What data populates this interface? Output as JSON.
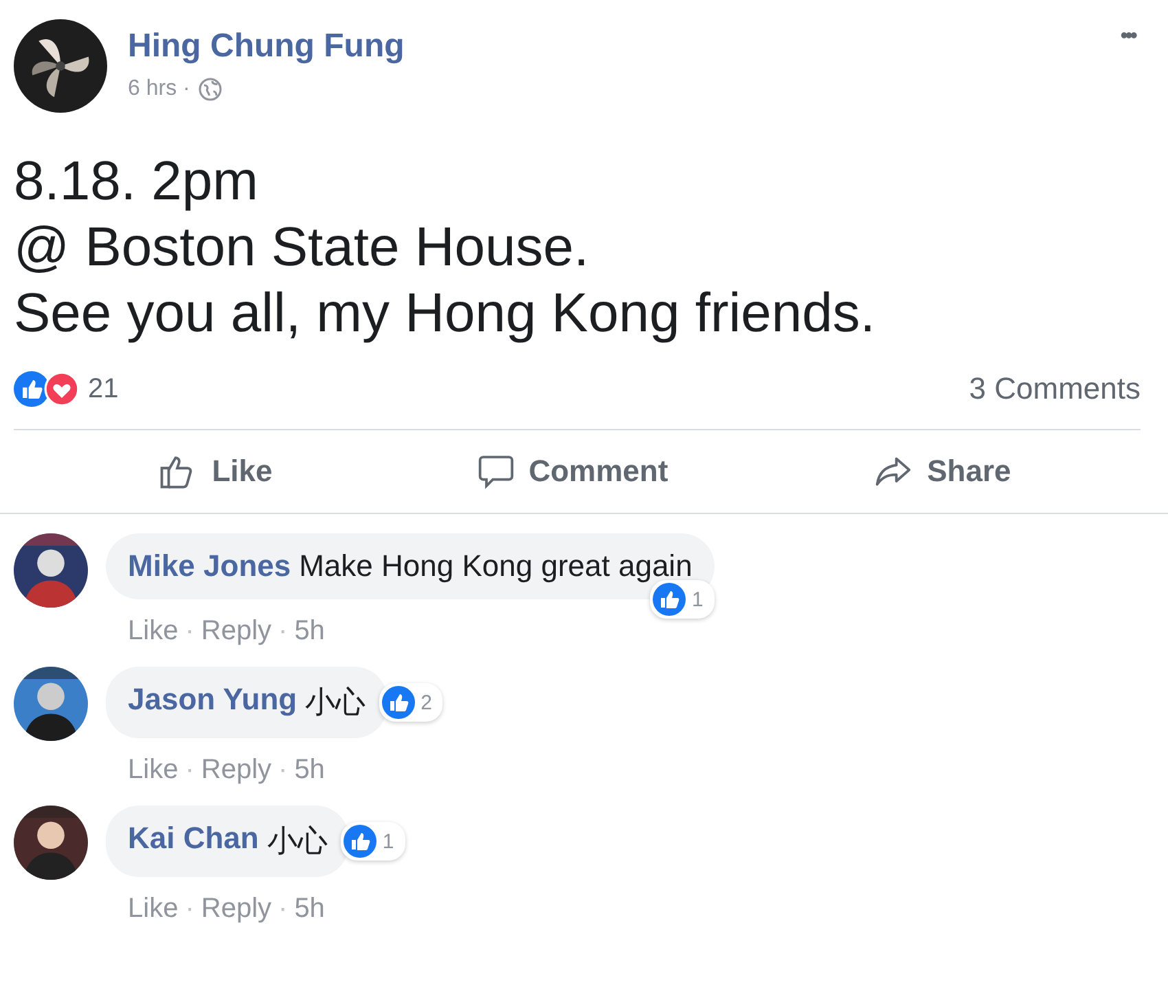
{
  "post": {
    "author": "Hing Chung Fung",
    "time": "6 hrs ·",
    "menu": "•••",
    "lines": [
      "8.18. 2pm",
      "@ Boston State House.",
      "See you all, my Hong Kong friends."
    ],
    "reactions": {
      "count": "21"
    },
    "comments_count": "3 Comments"
  },
  "actions": [
    {
      "kind": "like",
      "label": "Like"
    },
    {
      "kind": "comment",
      "label": "Comment"
    },
    {
      "kind": "share",
      "label": "Share"
    }
  ],
  "comments": [
    {
      "author": "Mike Jones",
      "text": "Make Hong Kong great again",
      "likes": "1",
      "kind": "long",
      "meta": [
        {
          "label": "Like"
        },
        {
          "label": "·"
        },
        {
          "label": "Reply"
        },
        {
          "label": "·"
        },
        {
          "label": "5h"
        }
      ]
    },
    {
      "author": "Jason Yung",
      "text": "小心",
      "likes": "2",
      "kind": "short",
      "meta": [
        {
          "label": "Like"
        },
        {
          "label": "·"
        },
        {
          "label": "Reply"
        },
        {
          "label": "·"
        },
        {
          "label": "5h"
        }
      ]
    },
    {
      "author": "Kai Chan",
      "text": "小心",
      "likes": "1",
      "kind": "short",
      "meta": [
        {
          "label": "Like"
        },
        {
          "label": "·"
        },
        {
          "label": "Reply"
        },
        {
          "label": "·"
        },
        {
          "label": "5h"
        }
      ]
    }
  ]
}
